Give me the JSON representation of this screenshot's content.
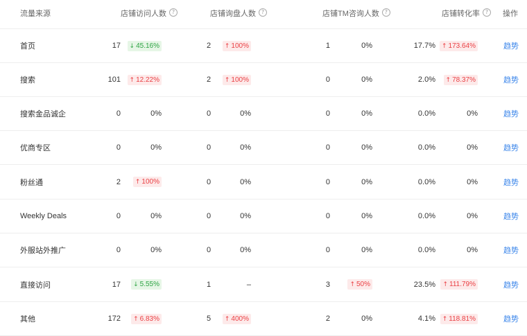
{
  "headers": {
    "source": "流量来源",
    "visitors": "店铺访问人数",
    "inquirers": "店铺询盘人数",
    "tm_inquirers": "店铺TM咨询人数",
    "conversion": "店铺转化率",
    "action": "操作"
  },
  "rows": [
    {
      "source": "首页",
      "visitors": "17",
      "visitors_change": {
        "text": "45.16%",
        "dir": "down"
      },
      "inquirers": "2",
      "inquirers_change": {
        "text": "100%",
        "dir": "up"
      },
      "tm": "1",
      "tm_change": {
        "text": "0%",
        "dir": "none"
      },
      "conv": "17.7%",
      "conv_change": {
        "text": "173.64%",
        "dir": "up"
      },
      "action": "趋势"
    },
    {
      "source": "搜索",
      "visitors": "101",
      "visitors_change": {
        "text": "12.22%",
        "dir": "up"
      },
      "inquirers": "2",
      "inquirers_change": {
        "text": "100%",
        "dir": "up"
      },
      "tm": "0",
      "tm_change": {
        "text": "0%",
        "dir": "none"
      },
      "conv": "2.0%",
      "conv_change": {
        "text": "78.37%",
        "dir": "up"
      },
      "action": "趋势"
    },
    {
      "source": "搜索金品诚企",
      "visitors": "0",
      "visitors_change": {
        "text": "0%",
        "dir": "none"
      },
      "inquirers": "0",
      "inquirers_change": {
        "text": "0%",
        "dir": "none"
      },
      "tm": "0",
      "tm_change": {
        "text": "0%",
        "dir": "none"
      },
      "conv": "0.0%",
      "conv_change": {
        "text": "0%",
        "dir": "none"
      },
      "action": "趋势"
    },
    {
      "source": "优商专区",
      "visitors": "0",
      "visitors_change": {
        "text": "0%",
        "dir": "none"
      },
      "inquirers": "0",
      "inquirers_change": {
        "text": "0%",
        "dir": "none"
      },
      "tm": "0",
      "tm_change": {
        "text": "0%",
        "dir": "none"
      },
      "conv": "0.0%",
      "conv_change": {
        "text": "0%",
        "dir": "none"
      },
      "action": "趋势"
    },
    {
      "source": "粉丝通",
      "visitors": "2",
      "visitors_change": {
        "text": "100%",
        "dir": "up"
      },
      "inquirers": "0",
      "inquirers_change": {
        "text": "0%",
        "dir": "none"
      },
      "tm": "0",
      "tm_change": {
        "text": "0%",
        "dir": "none"
      },
      "conv": "0.0%",
      "conv_change": {
        "text": "0%",
        "dir": "none"
      },
      "action": "趋势"
    },
    {
      "source": "Weekly Deals",
      "visitors": "0",
      "visitors_change": {
        "text": "0%",
        "dir": "none"
      },
      "inquirers": "0",
      "inquirers_change": {
        "text": "0%",
        "dir": "none"
      },
      "tm": "0",
      "tm_change": {
        "text": "0%",
        "dir": "none"
      },
      "conv": "0.0%",
      "conv_change": {
        "text": "0%",
        "dir": "none"
      },
      "action": "趋势"
    },
    {
      "source": "外服站外推广",
      "visitors": "0",
      "visitors_change": {
        "text": "0%",
        "dir": "none"
      },
      "inquirers": "0",
      "inquirers_change": {
        "text": "0%",
        "dir": "none"
      },
      "tm": "0",
      "tm_change": {
        "text": "0%",
        "dir": "none"
      },
      "conv": "0.0%",
      "conv_change": {
        "text": "0%",
        "dir": "none"
      },
      "action": "趋势"
    },
    {
      "source": "直接访问",
      "visitors": "17",
      "visitors_change": {
        "text": "5.55%",
        "dir": "down"
      },
      "inquirers": "1",
      "inquirers_change": {
        "text": "–",
        "dir": "none"
      },
      "tm": "3",
      "tm_change": {
        "text": "50%",
        "dir": "up"
      },
      "conv": "23.5%",
      "conv_change": {
        "text": "111.79%",
        "dir": "up"
      },
      "action": "趋势"
    },
    {
      "source": "其他",
      "visitors": "172",
      "visitors_change": {
        "text": "6.83%",
        "dir": "up"
      },
      "inquirers": "5",
      "inquirers_change": {
        "text": "400%",
        "dir": "up"
      },
      "tm": "2",
      "tm_change": {
        "text": "0%",
        "dir": "none"
      },
      "conv": "4.1%",
      "conv_change": {
        "text": "118.81%",
        "dir": "up"
      },
      "action": "趋势"
    }
  ],
  "icons": {
    "help": "question-circle-icon",
    "up": "arrow-up-icon",
    "down": "arrow-down-icon"
  },
  "colors": {
    "up_text": "#ea3f43",
    "up_bg": "#fdeaea",
    "down_text": "#2ea444",
    "down_bg": "#e6f6e6",
    "link": "#3b86ea"
  }
}
